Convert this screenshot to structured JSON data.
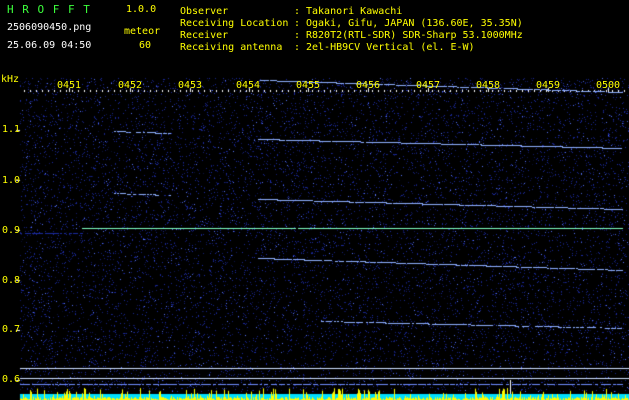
{
  "header": {
    "app_name": "H R O F F T",
    "version": "1.0.0",
    "filename": "2506090450.png",
    "meteor_label": "meteor",
    "datetime": "25.06.09 04:50",
    "meteor_count": "60",
    "info_labels": [
      "Observer",
      "Receiving Location",
      "Receiver",
      "Receiving antenna"
    ],
    "info_colons": [
      ":",
      ":",
      ":",
      ":"
    ],
    "info_values": [
      "Takanori Kawachi",
      "Ogaki, Gifu, JAPAN (136.60E, 35.35N)",
      "R820T2(RTL-SDR) SDR-Sharp 53.1000MHz",
      "2el-HB9CV Vertical (el. E-W)"
    ]
  },
  "spectrogram": {
    "y_unit": "kHz",
    "y_ticks": [
      "1.1",
      "1.0",
      "0.9",
      "0.8",
      "0.7",
      "0.6"
    ],
    "time_ticks": [
      "0451",
      "0452",
      "0453",
      "0454",
      "0455",
      "0456",
      "0457",
      "0458",
      "0459",
      "0500"
    ],
    "colors": {
      "background": "#000000",
      "noise": "#1a2aa0",
      "trace": "#8fb0ff",
      "carrier": "#7fffc0",
      "amplitude_bar": "#ffff00",
      "amplitude_base": "#00e0ff"
    }
  }
}
